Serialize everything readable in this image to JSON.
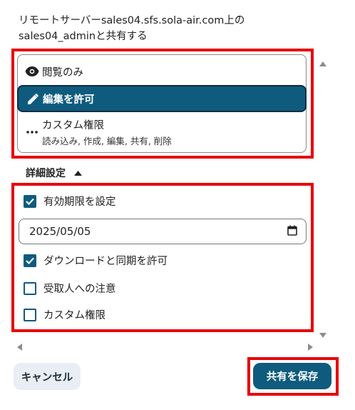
{
  "dialog": {
    "share_description": "リモートサーバーsales04.sfs.sola-air.com上のsales04_adminと共有する"
  },
  "permissions": {
    "options": [
      {
        "label": "閲覧のみ",
        "icon": "eye-icon"
      },
      {
        "label": "編集を許可",
        "icon": "pencil-icon",
        "selected": true
      },
      {
        "label": "カスタム権限",
        "sublabel": "読み込み, 作成, 編集, 共有, 削除",
        "icon": "more-icon"
      }
    ]
  },
  "advanced": {
    "toggle_label": "詳細設定",
    "expanded": true,
    "set_expiration": {
      "label": "有効期限を設定",
      "checked": true
    },
    "expiration_date": "2025/05/05",
    "allow_download_sync": {
      "label": "ダウンロードと同期を許可",
      "checked": true
    },
    "note_to_recipient": {
      "label": "受取人への注意",
      "checked": false
    },
    "custom_permissions": {
      "label": "カスタム権限",
      "checked": false
    }
  },
  "buttons": {
    "cancel": "キャンセル",
    "save": "共有を保存"
  },
  "colors": {
    "primary": "#0f5b7e",
    "highlight": "#e8000a",
    "cancel_bg": "#e8eef3"
  }
}
